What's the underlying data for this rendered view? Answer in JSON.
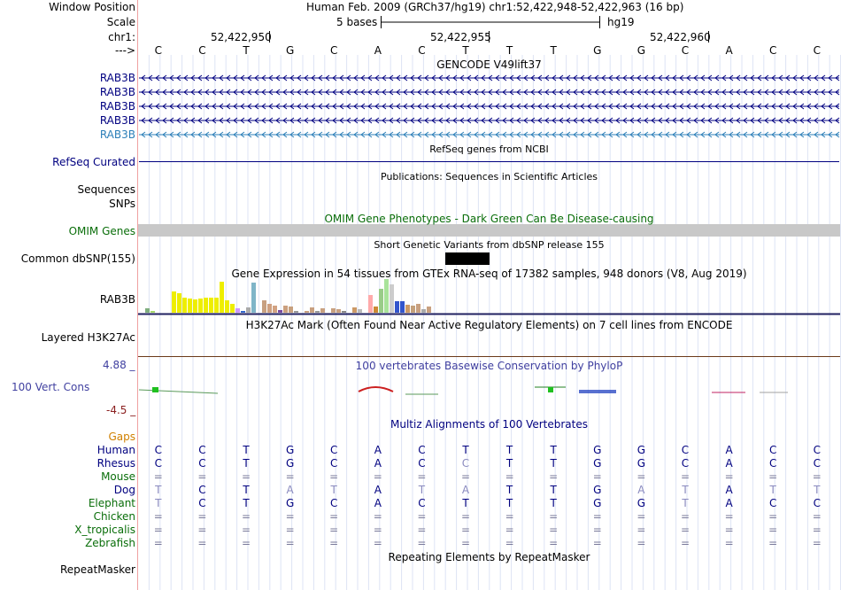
{
  "header": {
    "window_position_label": "Window Position",
    "window_position_value": "Human Feb. 2009 (GRCh37/hg19)   chr1:52,422,948-52,422,963 (16 bp)",
    "scale_label": "Scale",
    "scale_left": "5 bases",
    "scale_right": "hg19",
    "chrom_label": "chr1:",
    "arrow_label": "--->",
    "positions": [
      "52,422,950",
      "52,422,955",
      "52,422,960"
    ],
    "bases": [
      "C",
      "C",
      "T",
      "G",
      "C",
      "A",
      "C",
      "T",
      "T",
      "T",
      "G",
      "G",
      "C",
      "A",
      "C",
      "C"
    ]
  },
  "tracks": {
    "gencode": {
      "title": "GENCODE V49lift37",
      "genes": [
        "RAB3B",
        "RAB3B",
        "RAB3B",
        "RAB3B",
        "RAB3B"
      ]
    },
    "refseq": {
      "title": "RefSeq genes from NCBI",
      "label": "RefSeq Curated"
    },
    "publications": {
      "title": "Publications: Sequences in Scientific Articles",
      "label1": "Sequences",
      "label2": "SNPs"
    },
    "omim": {
      "title": "OMIM Gene Phenotypes - Dark Green Can Be Disease-causing",
      "label": "OMIM Genes"
    },
    "dbsnp": {
      "title": "Short Genetic Variants from dbSNP release 155",
      "label": "Common dbSNP(155)"
    },
    "gtex": {
      "title": "Gene Expression in 54 tissues from GTEx RNA-seq of 17382 samples, 948 donors (V8, Aug 2019)",
      "label": "RAB3B",
      "bar_values": [
        0.12,
        0.05,
        0.0,
        0.0,
        0.0,
        0.62,
        0.58,
        0.46,
        0.42,
        0.4,
        0.43,
        0.45,
        0.46,
        0.45,
        0.93,
        0.36,
        0.26,
        0.12,
        0.06,
        0.15,
        0.9,
        0.0,
        0.37,
        0.27,
        0.2,
        0.07,
        0.2,
        0.18,
        0.05,
        0.0,
        0.06,
        0.15,
        0.06,
        0.13,
        0.0,
        0.13,
        0.1,
        0.05,
        0.0,
        0.15,
        0.1,
        0.0,
        0.53,
        0.18,
        0.7,
        1.0,
        0.83,
        0.35,
        0.35,
        0.23,
        0.2,
        0.26,
        0.1,
        0.18
      ],
      "bar_colors": [
        "#7fae7f",
        "#a6d96a",
        "#ffffff",
        "#ffffff",
        "#ffffff",
        "#eeee00",
        "#eeee00",
        "#eeee00",
        "#eeee00",
        "#eeee00",
        "#eeee00",
        "#eeee00",
        "#eeee00",
        "#eeee00",
        "#eeee00",
        "#eeee00",
        "#eeee00",
        "#cc99ff",
        "#3366cc",
        "#aaaaaa",
        "#7fb5c8",
        "#ffffff",
        "#c8a080",
        "#cfa080",
        "#d2a282",
        "#7a4aa0",
        "#cba07f",
        "#c7a07e",
        "#999999",
        "#ffffff",
        "#c8a080",
        "#c8a080",
        "#999999",
        "#c8a080",
        "#ffffff",
        "#c8a080",
        "#c8a080",
        "#888888",
        "#ffffff",
        "#cc9966",
        "#bbbbbb",
        "#ffffff",
        "#ffaaaa",
        "#cc8833",
        "#99cc88",
        "#a9e39a",
        "#cccccc",
        "#3355cc",
        "#3355cc",
        "#cc9966",
        "#c4a07c",
        "#c8a080",
        "#aaaaaa",
        "#c8a080"
      ]
    },
    "h3k27ac": {
      "title": "H3K27Ac Mark (Often Found Near Active Regulatory Elements) on 7 cell lines from ENCODE",
      "label": "Layered H3K27Ac"
    },
    "phylop": {
      "title": "100 vertebrates Basewise Conservation by PhyloP",
      "label": "100 Vert. Cons",
      "max": "4.88 _",
      "min": "-4.5 _"
    },
    "multiz": {
      "title": "Multiz Alignments of 100 Vertebrates",
      "gaps_label": "Gaps",
      "species": [
        {
          "name": "Human",
          "bases": [
            "C",
            "C",
            "T",
            "G",
            "C",
            "A",
            "C",
            "T",
            "T",
            "T",
            "G",
            "G",
            "C",
            "A",
            "C",
            "C"
          ]
        },
        {
          "name": "Rhesus",
          "bases": [
            "C",
            "C",
            "T",
            "G",
            "C",
            "A",
            "C",
            "C",
            "T",
            "T",
            "G",
            "G",
            "C",
            "A",
            "C",
            "C"
          ]
        },
        {
          "name": "Mouse",
          "bases": [
            "=",
            "=",
            "=",
            "=",
            "=",
            "=",
            "=",
            "=",
            "=",
            "=",
            "=",
            "=",
            "=",
            "=",
            "=",
            "="
          ]
        },
        {
          "name": "Dog",
          "bases": [
            "T",
            "C",
            "T",
            "A",
            "T",
            "A",
            "T",
            "A",
            "T",
            "T",
            "G",
            "A",
            "T",
            "A",
            "T",
            "T"
          ]
        },
        {
          "name": "Elephant",
          "bases": [
            "T",
            "C",
            "T",
            "G",
            "C",
            "A",
            "C",
            "T",
            "T",
            "T",
            "G",
            "G",
            "T",
            "A",
            "C",
            "C"
          ]
        },
        {
          "name": "Chicken",
          "bases": [
            "=",
            "=",
            "=",
            "=",
            "=",
            "=",
            "=",
            "=",
            "=",
            "=",
            "=",
            "=",
            "=",
            "=",
            "=",
            "="
          ]
        },
        {
          "name": "X_tropicalis",
          "bases": [
            "=",
            "=",
            "=",
            "=",
            "=",
            "=",
            "=",
            "=",
            "=",
            "=",
            "=",
            "=",
            "=",
            "=",
            "=",
            "="
          ]
        },
        {
          "name": "Zebrafish",
          "bases": [
            "=",
            "=",
            "=",
            "=",
            "=",
            "=",
            "=",
            "=",
            "=",
            "=",
            "=",
            "=",
            "=",
            "=",
            "=",
            "="
          ]
        }
      ]
    },
    "repeatmasker": {
      "title": "Repeating Elements by RepeatMasker",
      "label": "RepeatMasker"
    }
  },
  "colors": {
    "navy": "#000080",
    "teal": "#2c7fb8",
    "omim_green": "#0a6e0a",
    "phylo": "#4040a0"
  }
}
